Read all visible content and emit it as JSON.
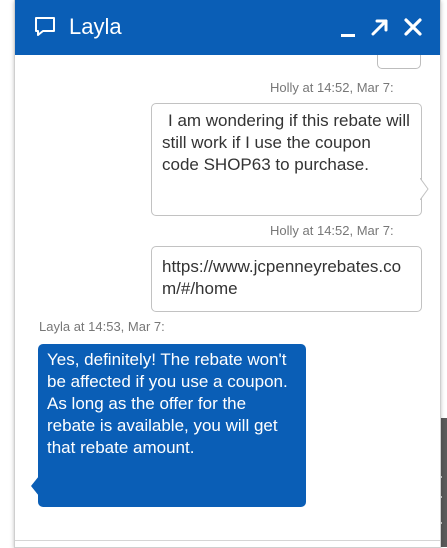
{
  "window": {
    "agent_name": "Layla",
    "controls": {
      "minimize": "_",
      "maximize": "↗",
      "close": "✕"
    },
    "accent_color": "#0a5eb6"
  },
  "messages": [
    {
      "sender": "Holly",
      "timestamp": "Holly at 14:52, Mar 7:",
      "text": "I am wondering if this rebate will still work if I use the coupon code SHOP63 to purchase."
    },
    {
      "sender": "Holly",
      "timestamp": "Holly at 14:52, Mar 7:",
      "text": "https://www.jcpenneyrebates.com/#/home"
    },
    {
      "sender": "Layla",
      "timestamp": "Layla at 14:53, Mar 7:",
      "text": "Yes, definitely! The rebate won't be affected if you use a coupon. As long as the offer for the rebate is available, you will get that rebate amount."
    }
  ]
}
